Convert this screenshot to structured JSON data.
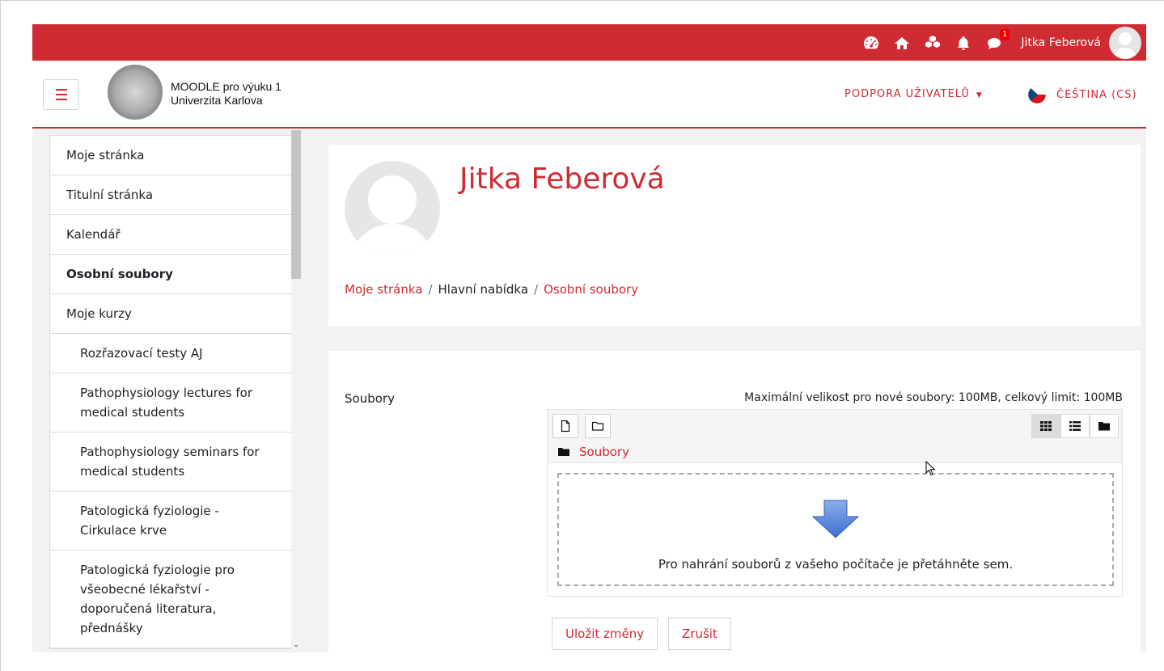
{
  "topbar": {
    "icons": [
      "dashboard-icon",
      "home-icon",
      "cubes-icon",
      "bell-icon",
      "chat-icon"
    ],
    "messages_badge": "1",
    "user_name": "Jitka Feberová"
  },
  "header": {
    "site_name_line1": "MOODLE pro výuku 1",
    "site_name_line2": "Univerzita Karlova",
    "support_menu": "PODPORA UŽIVATELŮ",
    "language": "ČEŠTINA (CS)"
  },
  "sidebar": {
    "items": [
      {
        "label": "Moje stránka"
      },
      {
        "label": "Titulní stránka"
      },
      {
        "label": "Kalendář"
      },
      {
        "label": "Osobní soubory"
      },
      {
        "label": "Moje kurzy"
      },
      {
        "label": "Rozřazovací testy AJ"
      },
      {
        "label": "Pathophysiology lectures for medical students"
      },
      {
        "label": "Pathophysiology seminars for medical students"
      },
      {
        "label": "Patologická fyziologie - Cirkulace krve"
      },
      {
        "label": "Patologická fyziologie pro všeobecné lékařství - doporučená literatura, přednášky"
      }
    ]
  },
  "profile": {
    "name": "Jitka Feberová"
  },
  "breadcrumb": {
    "items": [
      "Moje stránka",
      "Hlavní nabídka",
      "Osobní soubory"
    ]
  },
  "files": {
    "label": "Soubory",
    "limits": "Maximální velikost pro nové soubory: 100MB, celkový limit: 100MB",
    "path": "Soubory",
    "drop_text": "Pro nahrání souborů z vašeho počítače je přetáhněte sem."
  },
  "actions": {
    "save": "Uložit změny",
    "cancel": "Zrušit"
  },
  "colors": {
    "brand": "#cf2b33",
    "background": "#f2f2f2"
  }
}
